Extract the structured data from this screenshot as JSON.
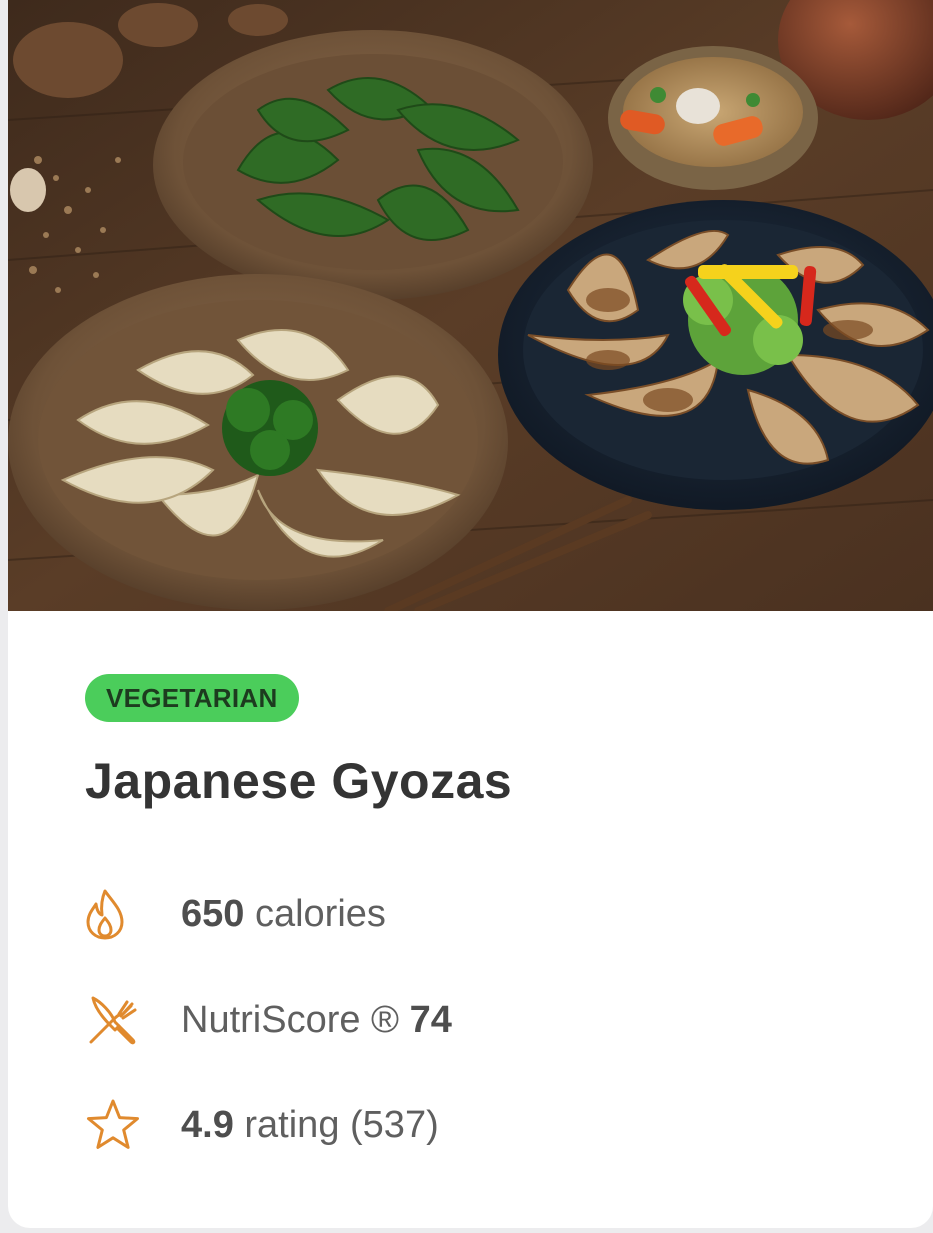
{
  "hero_image": {
    "subject": "japanese-gyoza-dumplings-photo"
  },
  "badge": {
    "label": "VEGETARIAN",
    "color": "#4bcd5b"
  },
  "recipe": {
    "title": "Japanese Gyozas"
  },
  "stats": {
    "calories": {
      "icon": "flame-icon",
      "value": "650",
      "unit": "calories"
    },
    "nutriscore": {
      "icon": "fork-knife-icon",
      "label": "NutriScore ®",
      "value": "74"
    },
    "rating": {
      "icon": "star-icon",
      "value": "4.9",
      "label": "rating",
      "count": "(537)"
    }
  },
  "colors": {
    "icon_accent": "#e08a2e",
    "title_text": "#343434",
    "body_text": "#5f5f5f"
  }
}
